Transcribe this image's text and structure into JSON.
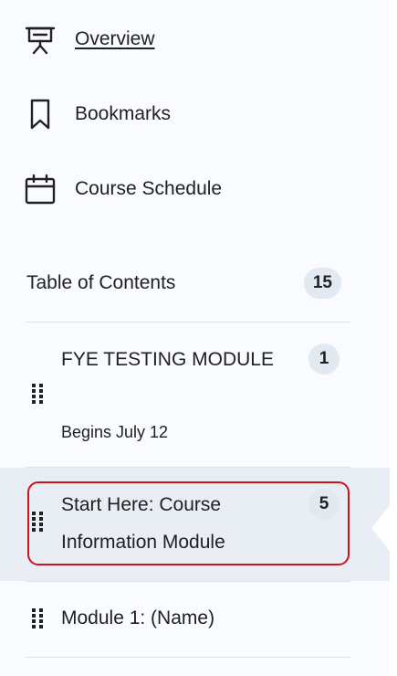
{
  "nav": {
    "overview": {
      "label": "Overview",
      "icon": "presentation-icon"
    },
    "bookmarks": {
      "label": "Bookmarks",
      "icon": "bookmark-icon"
    },
    "schedule": {
      "label": "Course Schedule",
      "icon": "calendar-icon"
    }
  },
  "toc": {
    "title": "Table of Contents",
    "count": "15",
    "modules": [
      {
        "title": "FYE TESTING MODULE",
        "subtitle": "Begins July 12",
        "count": "1"
      },
      {
        "title": "Start Here: Course Information Module",
        "count": "5",
        "selected": true
      },
      {
        "title": "Module 1: (Name)"
      }
    ]
  },
  "colors": {
    "panel_bg": "#f9fbff",
    "selected_bg": "#e9eef5",
    "badge_bg": "#e3e9f1",
    "highlight_border": "#d0121b",
    "text": "#202122"
  }
}
